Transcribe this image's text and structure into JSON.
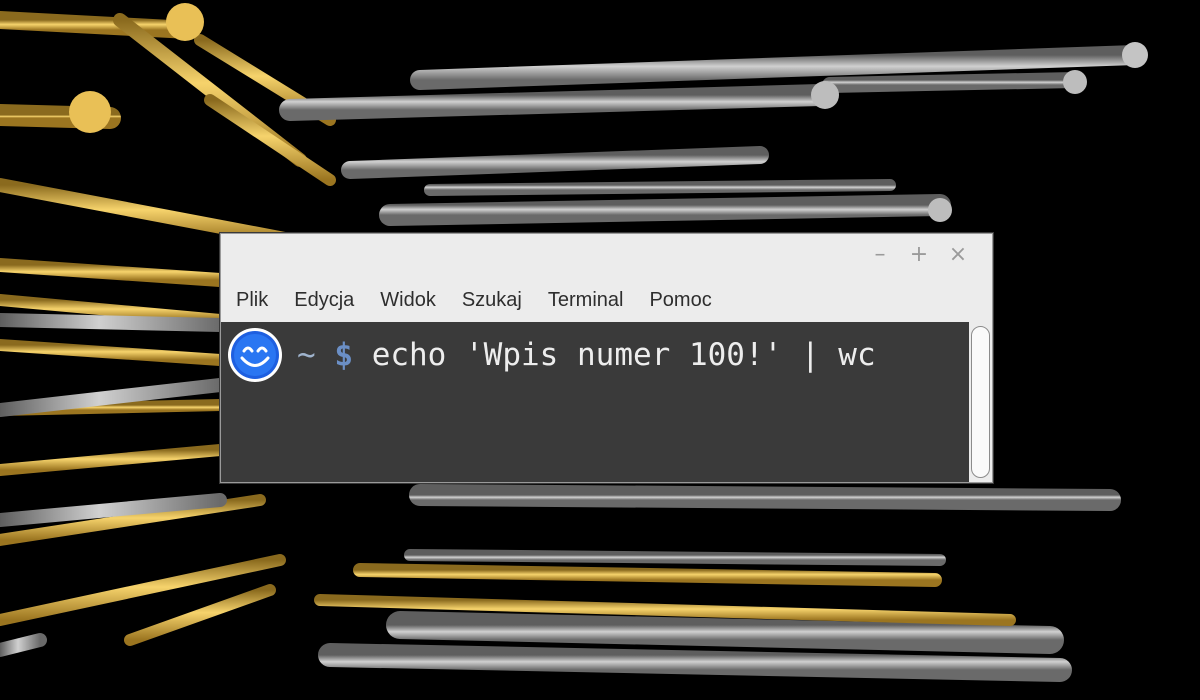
{
  "window": {
    "controls": {
      "minimize": "–",
      "maximize": "+",
      "close": "×"
    }
  },
  "menu": [
    "Plik",
    "Edycja",
    "Widok",
    "Szukaj",
    "Terminal",
    "Pomoc"
  ],
  "terminal": {
    "avatar_icon": "smiley-face-icon",
    "path": "~",
    "symbol": "$",
    "command": "echo 'Wpis numer 100!' | wc"
  },
  "background": {
    "description_icon": "3d-pipes-screensaver",
    "colors": {
      "yellow": "#e7b94a",
      "gray": "#a8a8a8",
      "black": "#000000"
    }
  }
}
